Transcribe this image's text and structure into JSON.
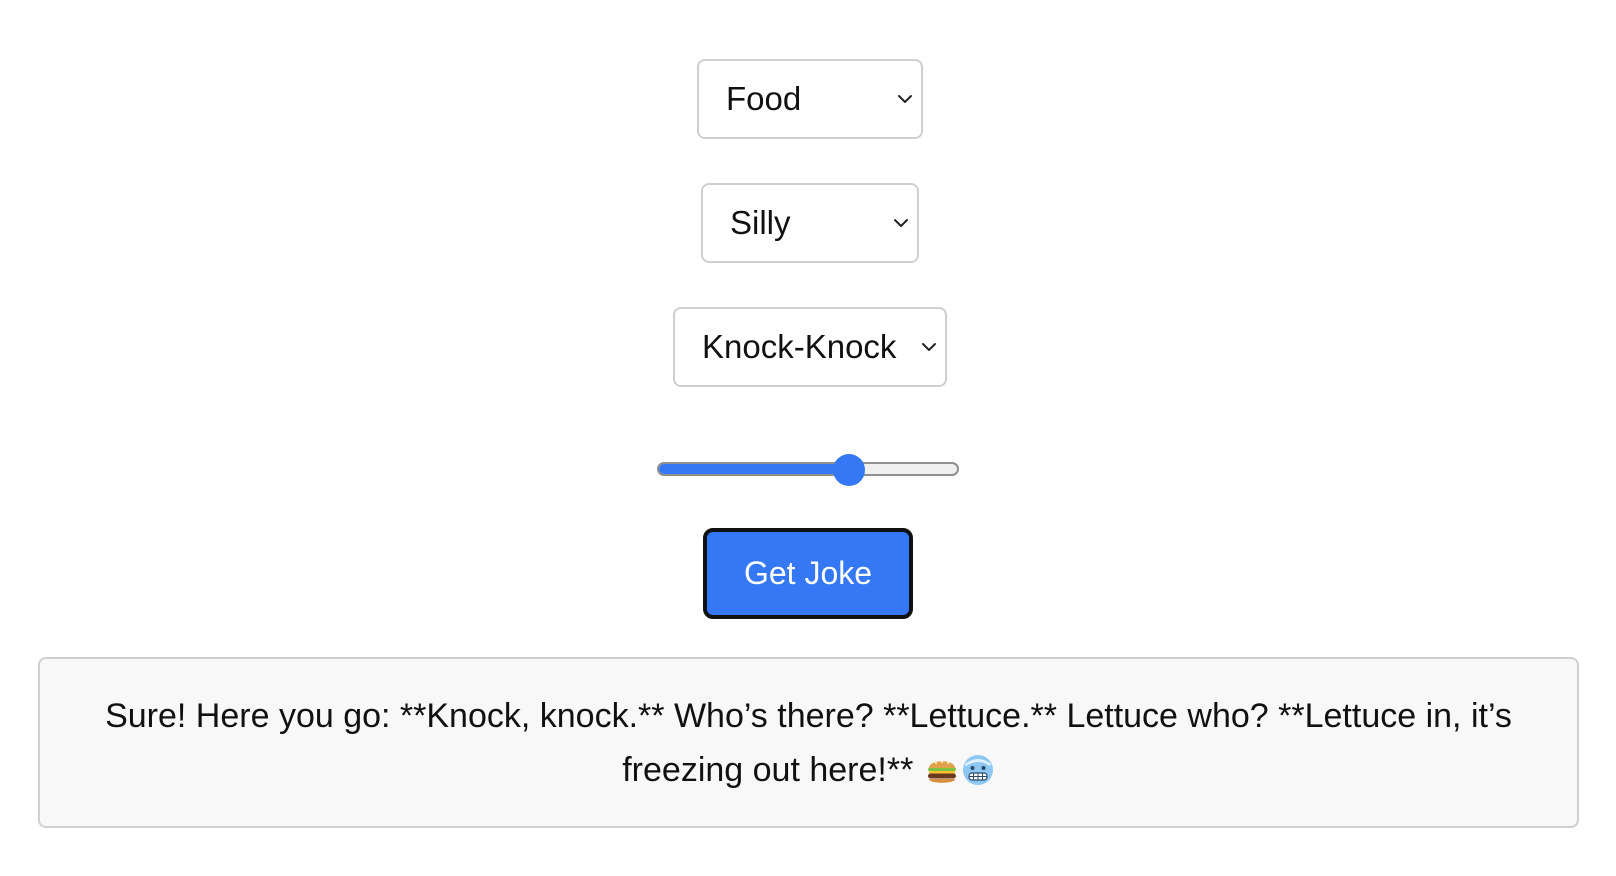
{
  "selects": {
    "category": {
      "value": "Food"
    },
    "tone": {
      "value": "Silly"
    },
    "type": {
      "value": "Knock-Knock"
    }
  },
  "slider": {
    "value_fraction": 0.65
  },
  "get_joke_button": {
    "label": "Get Joke"
  },
  "output": {
    "text": "Sure! Here you go: **Knock, knock.** Who’s there? **Lettuce.** Lettuce who? **Lettuce in, it’s freezing out here!**",
    "emojis": [
      "hamburger-icon",
      "cold-face-icon"
    ]
  },
  "colors": {
    "accent": "#3478f6",
    "output_background": "#f8f8f8",
    "border": "#cfcfcf"
  }
}
